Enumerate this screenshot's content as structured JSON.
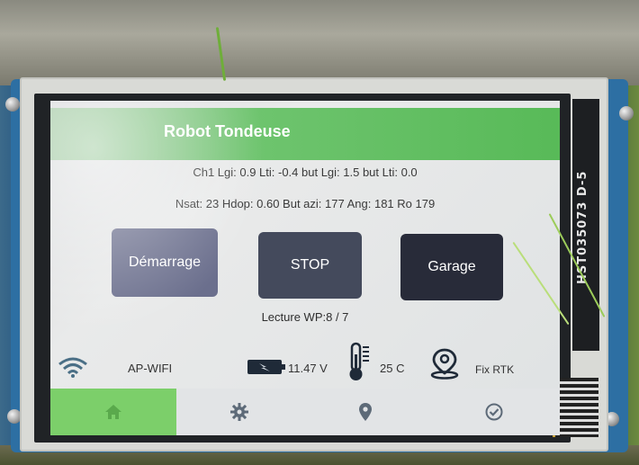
{
  "header": {
    "title": "Robot Tondeuse"
  },
  "info": {
    "line1": "Ch1 Lgi: 0.9 Lti: -0.4 but Lgi: 1.5 but Lti: 0.0",
    "line2": "Nsat: 23 Hdop: 0.60 But azi: 177 Ang: 181 Ro 179"
  },
  "buttons": {
    "start": "Démarrage",
    "stop": "STOP",
    "garage": "Garage"
  },
  "waypoint": "Lecture WP:8 / 7",
  "status": {
    "wifi_label": "AP-WIFI",
    "battery": "11.47 V",
    "temperature": "25  C",
    "gps_fix": "Fix RTK"
  },
  "navbar": {
    "items": [
      "home-icon",
      "gear-icon",
      "map-pin-icon",
      "check-circle-icon"
    ]
  },
  "device": {
    "module_label": "HST035073 D-5"
  },
  "colors": {
    "header_green": "#58ba58",
    "nav_active": "#7ccf6a",
    "btn_start": "#6b6f8d",
    "btn_stop": "#444a5c",
    "btn_garage": "#282b39"
  }
}
